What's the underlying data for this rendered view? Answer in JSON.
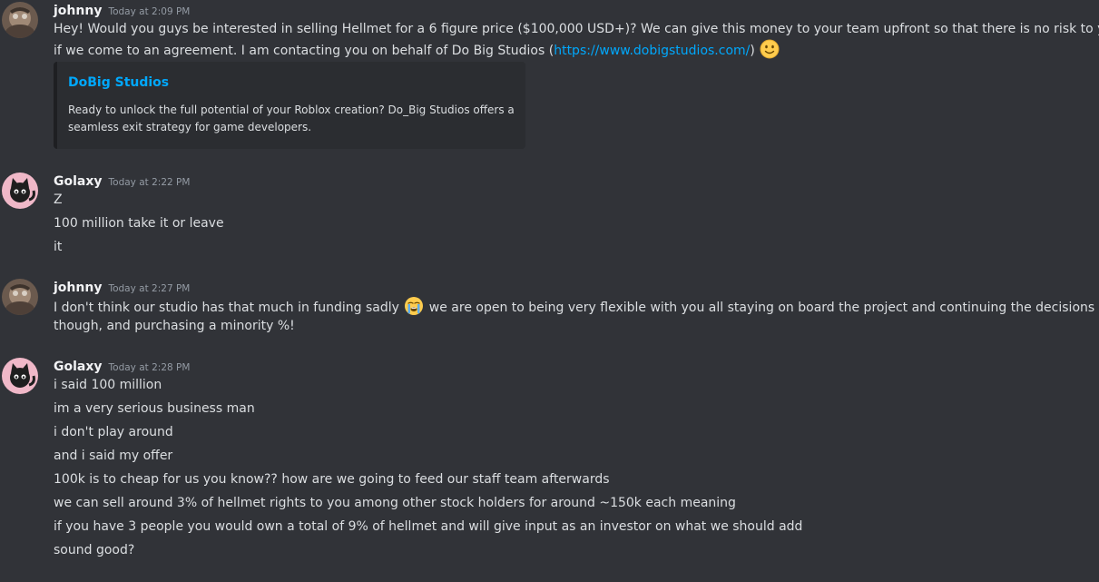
{
  "messages": [
    {
      "username": "johnny",
      "timestamp": "Today at 2:09 PM",
      "line1": "Hey! Would you guys be interested in selling Hellmet for a 6 figure price ($100,000 USD+)? We can give this money to your team upfront so that there is no risk to you,",
      "line2_before": "if we come to an agreement. I am contacting you on behalf of Do Big Studios (",
      "line2_link": "https://www.dobigstudios.com/",
      "line2_after": ")",
      "emoji": "slightly-smiling-face",
      "embed": {
        "title": "DoBig Studios",
        "desc_line1": "Ready to unlock the full potential of your Roblox creation? Do_Big Studios offers a",
        "desc_line2": "seamless exit strategy for game developers."
      }
    },
    {
      "username": "Golaxy",
      "timestamp": "Today at 2:22 PM",
      "lines": [
        "Z",
        "100 million take it or leave",
        "it"
      ]
    },
    {
      "username": "johnny",
      "timestamp": "Today at 2:27 PM",
      "line1_before": "I don't think our studio has that much in funding sadly",
      "line1_after": " we are open to being very flexible with you all staying on board the project and continuing the decisions",
      "line2": "though, and purchasing a minority %!",
      "emoji": "loudly-crying-face"
    },
    {
      "username": "Golaxy",
      "timestamp": "Today at 2:28 PM",
      "lines": [
        "i said 100 million",
        "im a very serious business man",
        "i don't play around",
        "and i said my offer",
        "100k is to cheap for us you know?? how are we going to feed our staff team afterwards",
        "we can sell around 3% of hellmet rights to you among other stock holders for around ~150k each meaning",
        "if you have 3 people you would own a total of 9% of hellmet and will give input as an investor on what we should add",
        "sound good?"
      ]
    }
  ],
  "colors": {
    "background": "#313338",
    "embed_background": "#2b2d31",
    "link": "#00a8fc",
    "username": "#f2f3f5",
    "text": "#dbdee1",
    "timestamp": "#949ba4"
  }
}
